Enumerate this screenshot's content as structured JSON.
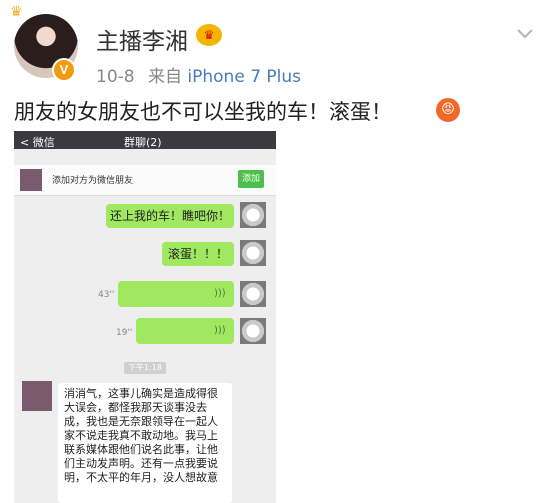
{
  "post": {
    "author": "主播李湘",
    "author_badge": "crown-badge",
    "date": "10-8",
    "source_prefix": "来自",
    "device": "iPhone 7 Plus",
    "text": "朋友的女朋友也不可以坐我的车！滚蛋！",
    "emoji": "angry-face-emoji",
    "avatar_verified_label": "V"
  },
  "chat_screenshot": {
    "nav_back": "微信",
    "nav_title": "群聊(2)",
    "add_prompt": "添加对方为微信朋友",
    "add_button": "添加",
    "messages": [
      {
        "text": "还上我的车！瞧吧你！"
      },
      {
        "text": "滚蛋！！！"
      }
    ],
    "voice_messages": [
      {
        "duration": "43''"
      },
      {
        "duration": "19''"
      }
    ],
    "time_chip": "下午1:18",
    "reply_lines": [
      "消消气，这事儿确实是造成得很",
      "大误会，都怪我那天谈事没去",
      "成，我也是无奈跟领导在一起人",
      "家不说走我真不敢动地。我马上",
      "联系媒体跟他们说名此事，让他",
      "们主动发声明。还有一点我要说",
      "明，不太平的年月，没人想故意"
    ]
  },
  "colors": {
    "bubble_green": "#9fe85f",
    "link_blue": "#4a7bbd",
    "nav_dark": "#3a3a3f"
  }
}
